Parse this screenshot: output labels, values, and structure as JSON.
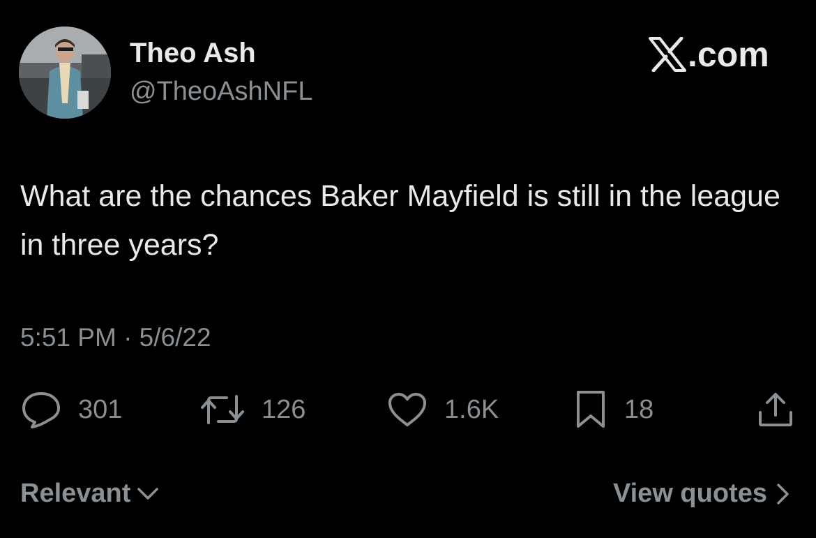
{
  "author": {
    "display_name": "Theo Ash",
    "handle": "@TheoAshNFL",
    "avatar_icon": "profile-photo"
  },
  "brand": {
    "label": ".com",
    "icon": "x-logo-icon"
  },
  "tweet": {
    "text": "What are the chances Baker Mayfield is still in the league in three years?",
    "timestamp": "5:51 PM · 5/6/22"
  },
  "actions": {
    "replies": "301",
    "reposts": "126",
    "likes": "1.6K",
    "bookmarks": "18",
    "reply_icon": "speech-bubble-icon",
    "repost_icon": "repost-arrows-icon",
    "like_icon": "heart-icon",
    "bookmark_icon": "bookmark-icon",
    "share_icon": "share-upload-icon"
  },
  "footer": {
    "sort_label": "Relevant",
    "quotes_label": "View quotes"
  },
  "colors": {
    "background": "#000000",
    "primary_text": "#e7e9ea",
    "secondary_text": "#8b9094"
  }
}
